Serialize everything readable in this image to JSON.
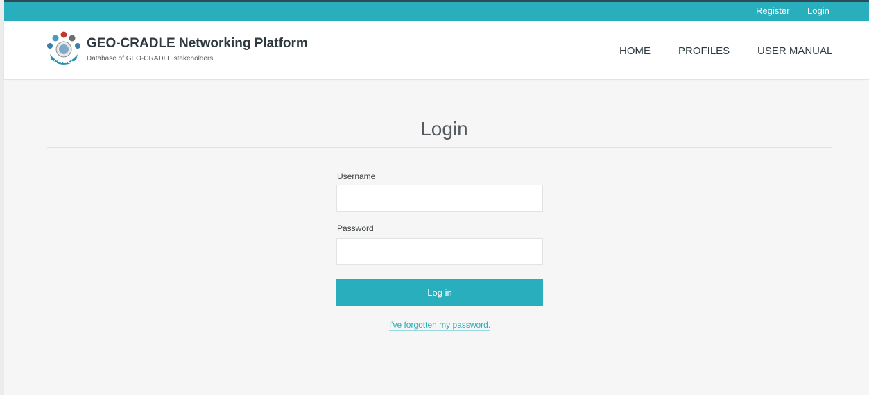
{
  "topbar": {
    "register_label": "Register",
    "login_label": "Login"
  },
  "header": {
    "logo_icon": "geo-cradle-logo-icon",
    "logo_text": "CRADLE",
    "title": "GEO-CRADLE Networking Platform",
    "subtitle": "Database of GEO-CRADLE stakeholders",
    "nav": {
      "home": "HOME",
      "profiles": "PROFILES",
      "user_manual": "USER MANUAL"
    }
  },
  "login_form": {
    "title": "Login",
    "username_label": "Username",
    "username_value": "",
    "password_label": "Password",
    "password_value": "",
    "submit_label": "Log in",
    "forgot_link": "I've forgotten my password."
  },
  "colors": {
    "accent": "#28aebd",
    "topbar_border": "#2d4d56",
    "main_background": "#f6f6f6",
    "text_dark": "#2e3a40"
  }
}
